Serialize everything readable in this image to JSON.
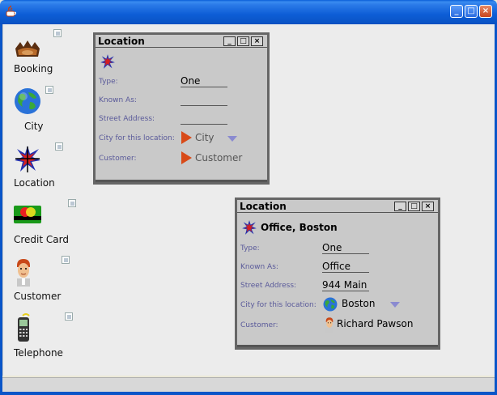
{
  "window": {
    "title": ""
  },
  "desktop_items": [
    {
      "label": "Booking",
      "icon": "booking-icon"
    },
    {
      "label": "City",
      "icon": "globe-icon"
    },
    {
      "label": "Location",
      "icon": "location-icon"
    },
    {
      "label": "Credit Card",
      "icon": "credit-card-icon"
    },
    {
      "label": "Customer",
      "icon": "customer-icon"
    },
    {
      "label": "Telephone",
      "icon": "telephone-icon"
    }
  ],
  "frame1": {
    "title": "Location",
    "heading": "",
    "labels": {
      "type": "Type:",
      "known_as": "Known As:",
      "street": "Street Address:",
      "city": "City for this location:",
      "customer": "Customer:"
    },
    "values": {
      "type": "One",
      "known_as": "",
      "street": "",
      "city": "City",
      "customer": "Customer"
    }
  },
  "frame2": {
    "title": "Location",
    "heading": "Office, Boston",
    "labels": {
      "type": "Type:",
      "known_as": "Known As:",
      "street": "Street Address:",
      "city": "City for this location:",
      "customer": "Customer:"
    },
    "values": {
      "type": "One",
      "known_as": "Office",
      "street": "944 Main",
      "city": "Boston",
      "customer": "Richard Pawson"
    }
  },
  "colors": {
    "xp_blue": "#0a55c8",
    "frame_gray": "#c9c9c9",
    "label_purple": "#5a5a9a"
  }
}
